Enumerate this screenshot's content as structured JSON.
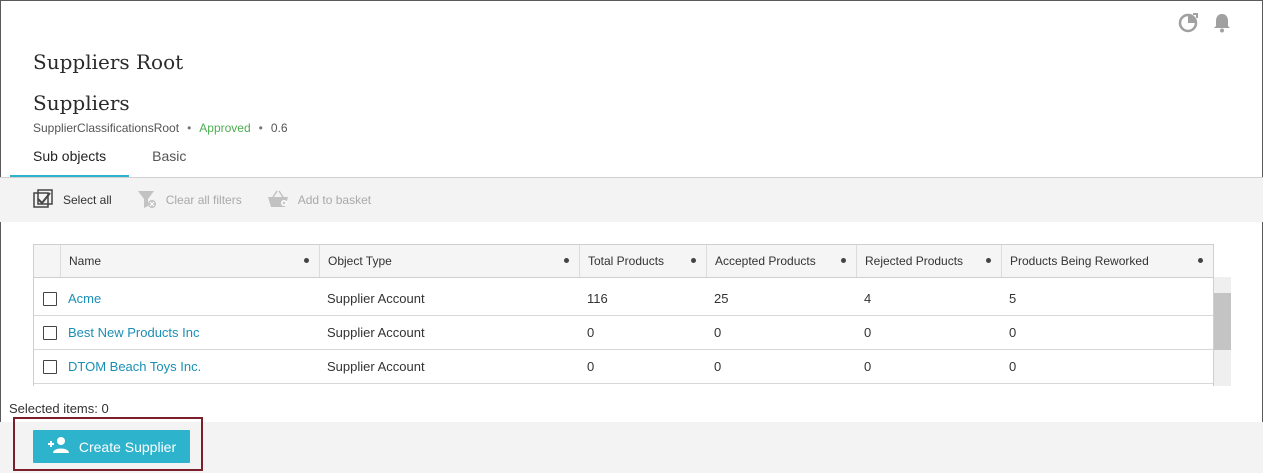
{
  "header": {
    "crumb_title": "Suppliers Root",
    "page_title": "Suppliers",
    "object_id": "SupplierClassificationsRoot",
    "status": "Approved",
    "version": "0.6",
    "separator": "•"
  },
  "tabs": [
    {
      "label": "Sub objects",
      "active": true
    },
    {
      "label": "Basic",
      "active": false
    }
  ],
  "toolbar": {
    "select_all": "Select all",
    "clear_filters": "Clear all filters",
    "add_to_basket": "Add to basket"
  },
  "table": {
    "columns": [
      "Name",
      "Object Type",
      "Total Products",
      "Accepted Products",
      "Rejected Products",
      "Products Being Reworked"
    ],
    "rows": [
      {
        "name": "Acme",
        "type": "Supplier Account",
        "total": "116",
        "accepted": "25",
        "rejected": "4",
        "reworked": "5"
      },
      {
        "name": "Best New Products Inc",
        "type": "Supplier Account",
        "total": "0",
        "accepted": "0",
        "rejected": "0",
        "reworked": "0"
      },
      {
        "name": "DTOM Beach Toys Inc.",
        "type": "Supplier Account",
        "total": "0",
        "accepted": "0",
        "rejected": "0",
        "reworked": "0"
      }
    ]
  },
  "selection": {
    "label": "Selected items: 0"
  },
  "actions": {
    "create_supplier": "Create Supplier"
  },
  "colors": {
    "accent": "#2eb3cc",
    "approved": "#4caf50",
    "link": "#1a8fb5",
    "highlight": "#7a1f2b"
  },
  "icons": [
    "refresh-icon",
    "bell-icon",
    "select-all-icon",
    "filter-clear-icon",
    "basket-icon",
    "add-person-icon"
  ]
}
